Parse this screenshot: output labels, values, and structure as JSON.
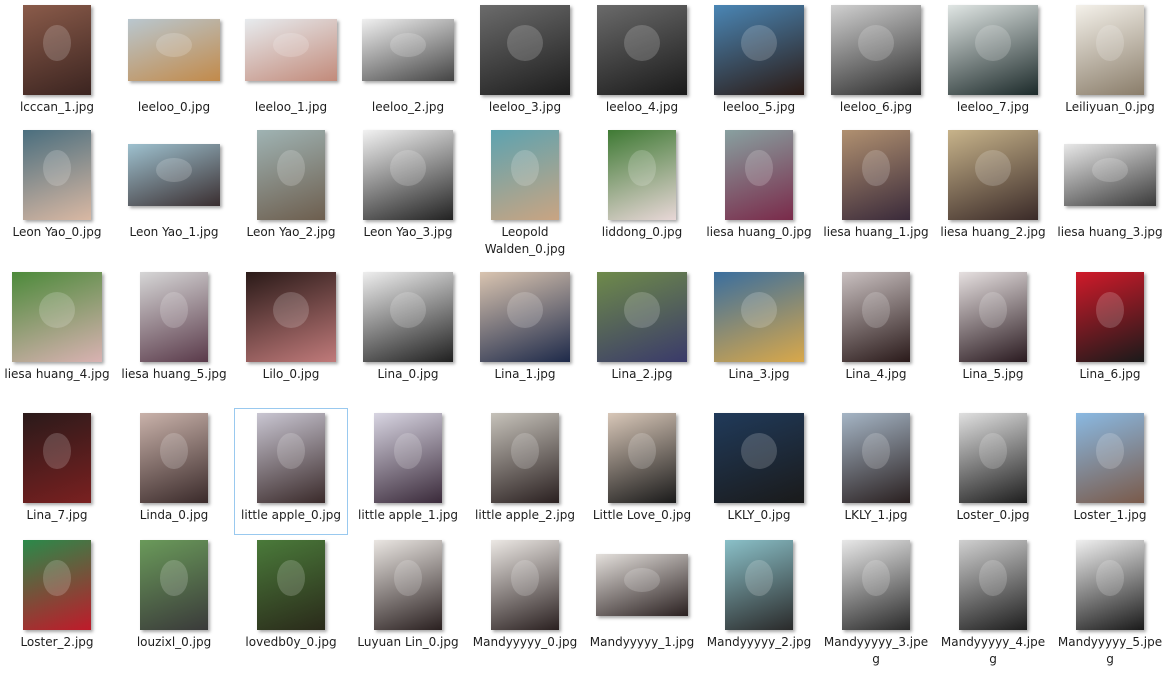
{
  "files": [
    {
      "name": "lcccan_1.jpg",
      "shape": "portrait",
      "c1": "#8a5b4a",
      "c2": "#3b2420"
    },
    {
      "name": "leeloo_0.jpg",
      "shape": "landscape",
      "c1": "#b9c7cf",
      "c2": "#c28a4a"
    },
    {
      "name": "leeloo_1.jpg",
      "shape": "landscape",
      "c1": "#e7ebee",
      "c2": "#c28a7a"
    },
    {
      "name": "leeloo_2.jpg",
      "shape": "landscape",
      "c1": "#f0f0f0",
      "c2": "#444444"
    },
    {
      "name": "leeloo_3.jpg",
      "shape": "square",
      "c1": "#6b6b6b",
      "c2": "#1d1d1d"
    },
    {
      "name": "leeloo_4.jpg",
      "shape": "square",
      "c1": "#6a6a6a",
      "c2": "#1a1a1a"
    },
    {
      "name": "leeloo_5.jpg",
      "shape": "square",
      "c1": "#4a86b5",
      "c2": "#2b1a14"
    },
    {
      "name": "leeloo_6.jpg",
      "shape": "square",
      "c1": "#d0d0d0",
      "c2": "#2a2a2a"
    },
    {
      "name": "leeloo_7.jpg",
      "shape": "square",
      "c1": "#e0e6e4",
      "c2": "#1c2a2a"
    },
    {
      "name": "Leiliyuan_0.jpg",
      "shape": "portrait",
      "c1": "#f4f1ea",
      "c2": "#8a7d6a"
    },
    {
      "name": "Leon Yao_0.jpg",
      "shape": "portrait",
      "c1": "#4a6e7e",
      "c2": "#d9b8a3"
    },
    {
      "name": "Leon Yao_1.jpg",
      "shape": "landscape",
      "c1": "#9ec1cf",
      "c2": "#3a2e30"
    },
    {
      "name": "Leon Yao_2.jpg",
      "shape": "portrait",
      "c1": "#9fb3b3",
      "c2": "#6d5e4e"
    },
    {
      "name": "Leon Yao_3.jpg",
      "shape": "square",
      "c1": "#f2f2f2",
      "c2": "#222222"
    },
    {
      "name": "Leopold Walden_0.jpg",
      "shape": "portrait",
      "c1": "#5da3b0",
      "c2": "#c9a482"
    },
    {
      "name": "liddong_0.jpg",
      "shape": "portrait",
      "c1": "#3f7a34",
      "c2": "#e8d7d7"
    },
    {
      "name": "liesa huang_0.jpg",
      "shape": "portrait",
      "c1": "#88a0a0",
      "c2": "#7a2a4a"
    },
    {
      "name": "liesa huang_1.jpg",
      "shape": "portrait",
      "c1": "#b09070",
      "c2": "#3a2a3a"
    },
    {
      "name": "liesa huang_2.jpg",
      "shape": "square",
      "c1": "#c7b38a",
      "c2": "#3a2a28"
    },
    {
      "name": "liesa huang_3.jpg",
      "shape": "landscape",
      "c1": "#e8e8e8",
      "c2": "#3a3a3a"
    },
    {
      "name": "liesa huang_4.jpg",
      "shape": "square",
      "c1": "#4c8a3a",
      "c2": "#d9b2b2"
    },
    {
      "name": "liesa huang_5.jpg",
      "shape": "portrait",
      "c1": "#d6d6d6",
      "c2": "#5a3a4a"
    },
    {
      "name": "Lilo_0.jpg",
      "shape": "square",
      "c1": "#2a1a18",
      "c2": "#c07a7a"
    },
    {
      "name": "Lina_0.jpg",
      "shape": "square",
      "c1": "#eeeeee",
      "c2": "#202020"
    },
    {
      "name": "Lina_1.jpg",
      "shape": "square",
      "c1": "#d9c4b0",
      "c2": "#1e2a4a"
    },
    {
      "name": "Lina_2.jpg",
      "shape": "square",
      "c1": "#6e8a4a",
      "c2": "#3a3a6a"
    },
    {
      "name": "Lina_3.jpg",
      "shape": "square",
      "c1": "#3a6e9e",
      "c2": "#d9a84a"
    },
    {
      "name": "Lina_4.jpg",
      "shape": "portrait",
      "c1": "#c9c0c0",
      "c2": "#2a1a1a"
    },
    {
      "name": "Lina_5.jpg",
      "shape": "portrait",
      "c1": "#e6e0e0",
      "c2": "#2a1a20"
    },
    {
      "name": "Lina_6.jpg",
      "shape": "portrait",
      "c1": "#d01a2a",
      "c2": "#1a1a1a"
    },
    {
      "name": "Lina_7.jpg",
      "shape": "portrait",
      "c1": "#2a1a1a",
      "c2": "#7a2020"
    },
    {
      "name": "Linda_0.jpg",
      "shape": "portrait",
      "c1": "#c9b2aa",
      "c2": "#3a2a2a"
    },
    {
      "name": "little apple_0.jpg",
      "shape": "portrait",
      "c1": "#c9c6d2",
      "c2": "#3a2a2a"
    },
    {
      "name": "little apple_1.jpg",
      "shape": "portrait",
      "c1": "#d8d5e2",
      "c2": "#3a2a3a"
    },
    {
      "name": "little apple_2.jpg",
      "shape": "portrait",
      "c1": "#c6c2ba",
      "c2": "#2a2020"
    },
    {
      "name": "Little Love_0.jpg",
      "shape": "portrait",
      "c1": "#d8c7b8",
      "c2": "#1a1a1a"
    },
    {
      "name": "LKLY_0.jpg",
      "shape": "square",
      "c1": "#203a5a",
      "c2": "#1a1a1a"
    },
    {
      "name": "LKLY_1.jpg",
      "shape": "portrait",
      "c1": "#a5b5c5",
      "c2": "#2a2020"
    },
    {
      "name": "Loster_0.jpg",
      "shape": "portrait",
      "c1": "#e0e0e0",
      "c2": "#1e1e1e"
    },
    {
      "name": "Loster_1.jpg",
      "shape": "portrait",
      "c1": "#8ab9e2",
      "c2": "#7a5a4a"
    },
    {
      "name": "Loster_2.jpg",
      "shape": "portrait",
      "c1": "#2a8a4a",
      "c2": "#c01a2a"
    },
    {
      "name": "louzixl_0.jpg",
      "shape": "portrait",
      "c1": "#6a9a5a",
      "c2": "#3a3a3a"
    },
    {
      "name": "lovedb0y_0.jpg",
      "shape": "portrait",
      "c1": "#4a7a3a",
      "c2": "#2a2a1a"
    },
    {
      "name": "Luyuan Lin_0.jpg",
      "shape": "portrait",
      "c1": "#eae6e2",
      "c2": "#2a2020"
    },
    {
      "name": "Mandyyyyy_0.jpg",
      "shape": "portrait",
      "c1": "#ece8e4",
      "c2": "#2a2020"
    },
    {
      "name": "Mandyyyyy_1.jpg",
      "shape": "landscape",
      "c1": "#e4e0dc",
      "c2": "#2a2020"
    },
    {
      "name": "Mandyyyyy_2.jpg",
      "shape": "portrait",
      "c1": "#8ac0c8",
      "c2": "#2a2a2a"
    },
    {
      "name": "Mandyyyyy_3.jpeg",
      "shape": "portrait",
      "c1": "#e8e8e8",
      "c2": "#2a2a2a"
    },
    {
      "name": "Mandyyyyy_4.jpeg",
      "shape": "portrait",
      "c1": "#d0d0d0",
      "c2": "#1e1e1e"
    },
    {
      "name": "Mandyyyyy_5.jpeg",
      "shape": "portrait",
      "c1": "#f0f0f0",
      "c2": "#1a1a1a"
    }
  ],
  "selected_index": 32,
  "colors": {
    "selection_border": "#99c9ef",
    "text": "#1e1e1e",
    "background": "#ffffff"
  }
}
